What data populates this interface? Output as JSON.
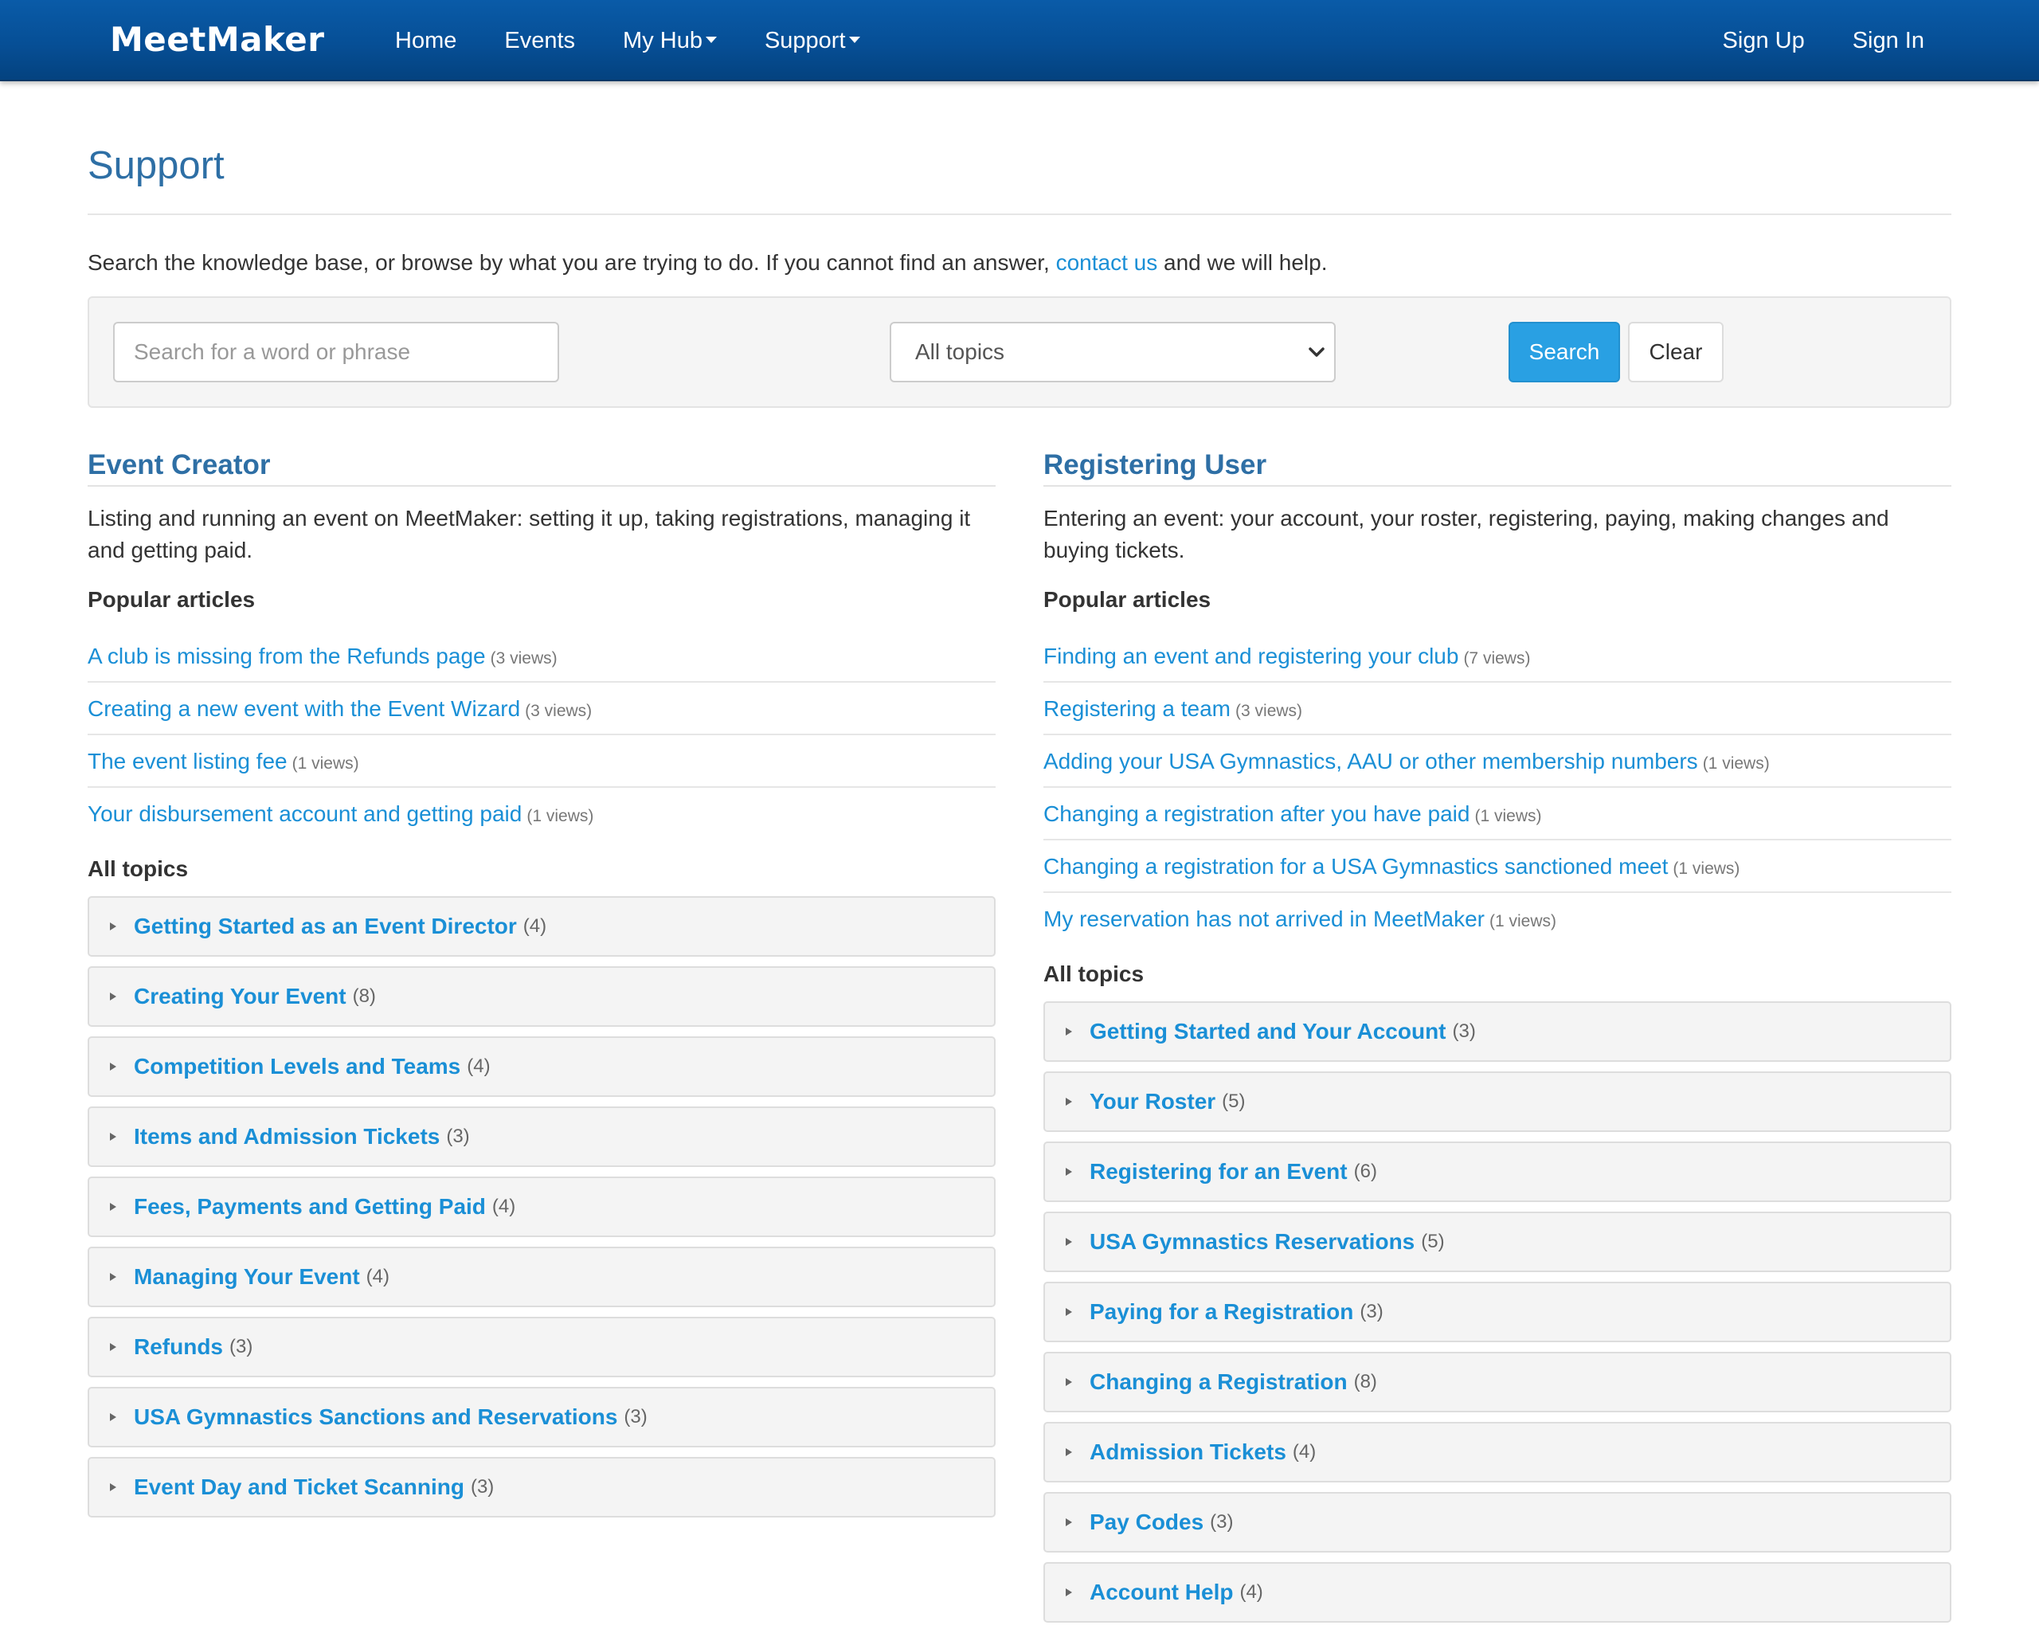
{
  "navbar": {
    "brand": "MeetMaker",
    "items": [
      "Home",
      "Events",
      "My Hub",
      "Support"
    ],
    "right": [
      "Sign Up",
      "Sign In"
    ]
  },
  "page": {
    "title": "Support",
    "intro_before": "Search the knowledge base, or browse by what you are trying to do. If you cannot find an answer, ",
    "intro_link": "contact us",
    "intro_after": " and we will help."
  },
  "search": {
    "placeholder": "Search for a word or phrase",
    "select_value": "All topics",
    "search_label": "Search",
    "clear_label": "Clear"
  },
  "columns": [
    {
      "heading": "Event Creator",
      "description": "Listing and running an event on MeetMaker: setting it up, taking registrations, managing it and getting paid.",
      "popular_label": "Popular articles",
      "articles": [
        {
          "title": "A club is missing from the Refunds page",
          "views": "(3 views)"
        },
        {
          "title": "Creating a new event with the Event Wizard",
          "views": "(3 views)"
        },
        {
          "title": "The event listing fee",
          "views": "(1 views)"
        },
        {
          "title": "Your disbursement account and getting paid",
          "views": "(1 views)"
        }
      ],
      "topics_label": "All topics",
      "topics": [
        {
          "name": "Getting Started as an Event Director",
          "count": "(4)"
        },
        {
          "name": "Creating Your Event",
          "count": "(8)"
        },
        {
          "name": "Competition Levels and Teams",
          "count": "(4)"
        },
        {
          "name": "Items and Admission Tickets",
          "count": "(3)"
        },
        {
          "name": "Fees, Payments and Getting Paid",
          "count": "(4)"
        },
        {
          "name": "Managing Your Event",
          "count": "(4)"
        },
        {
          "name": "Refunds",
          "count": "(3)"
        },
        {
          "name": "USA Gymnastics Sanctions and Reservations",
          "count": "(3)"
        },
        {
          "name": "Event Day and Ticket Scanning",
          "count": "(3)"
        }
      ]
    },
    {
      "heading": "Registering User",
      "description": "Entering an event: your account, your roster, registering, paying, making changes and buying tickets.",
      "popular_label": "Popular articles",
      "articles": [
        {
          "title": "Finding an event and registering your club",
          "views": "(7 views)"
        },
        {
          "title": "Registering a team",
          "views": "(3 views)"
        },
        {
          "title": "Adding your USA Gymnastics, AAU or other membership numbers",
          "views": "(1 views)"
        },
        {
          "title": "Changing a registration after you have paid",
          "views": "(1 views)"
        },
        {
          "title": "Changing a registration for a USA Gymnastics sanctioned meet",
          "views": "(1 views)"
        },
        {
          "title": "My reservation has not arrived in MeetMaker",
          "views": "(1 views)"
        }
      ],
      "topics_label": "All topics",
      "topics": [
        {
          "name": "Getting Started and Your Account",
          "count": "(3)"
        },
        {
          "name": "Your Roster",
          "count": "(5)"
        },
        {
          "name": "Registering for an Event",
          "count": "(6)"
        },
        {
          "name": "USA Gymnastics Reservations",
          "count": "(5)"
        },
        {
          "name": "Paying for a Registration",
          "count": "(3)"
        },
        {
          "name": "Changing a Registration",
          "count": "(8)"
        },
        {
          "name": "Admission Tickets",
          "count": "(4)"
        },
        {
          "name": "Pay Codes",
          "count": "(3)"
        },
        {
          "name": "Account Help",
          "count": "(4)"
        }
      ]
    }
  ]
}
